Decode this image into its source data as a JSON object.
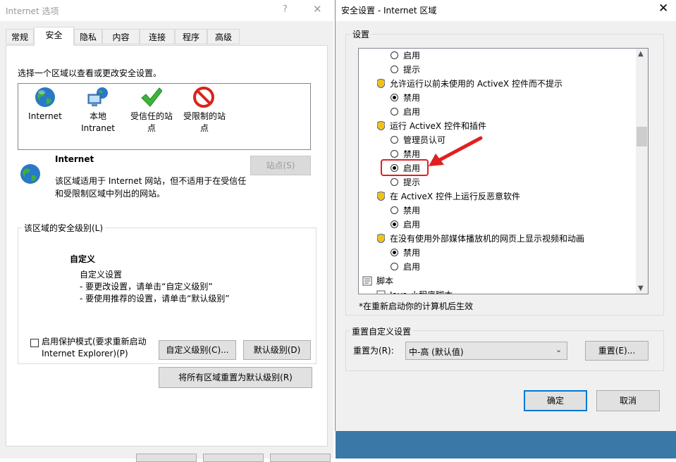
{
  "left": {
    "title": "Internet 选项",
    "help": "?",
    "close": "✕",
    "tabs": [
      "常规",
      "安全",
      "隐私",
      "内容",
      "连接",
      "程序",
      "高级"
    ],
    "active_tab": "安全",
    "zone_prompt": "选择一个区域以查看或更改安全设置。",
    "zones": [
      {
        "label": "Internet",
        "icon": "globe-icon"
      },
      {
        "label": "本地 Intranet",
        "icon": "intranet-icon"
      },
      {
        "label": "受信任的站点",
        "icon": "checkmark-icon"
      },
      {
        "label": "受限制的站点",
        "icon": "restricted-icon"
      }
    ],
    "selected_zone_title": "Internet",
    "selected_zone_desc": "该区域适用于 Internet 网站，但不适用于在受信任和受限制区域中列出的网站。",
    "sites_button": "站点(S)",
    "level_group_label": "该区域的安全级别(L)",
    "level_name": "自定义",
    "level_lines": [
      "自定义设置",
      "- 要更改设置，请单击“自定义级别”",
      "- 要使用推荐的设置，请单击“默认级别”"
    ],
    "protected_mode_label": "启用保护模式(要求重新启动 Internet Explorer)(P)",
    "custom_level_button": "自定义级别(C)...",
    "default_level_button": "默认级别(D)",
    "reset_all_button": "将所有区域重置为默认级别(R)"
  },
  "right": {
    "title": "安全设置 - Internet 区域",
    "close": "✕",
    "settings_label": "设置",
    "rows": [
      {
        "type": "radio",
        "label": "启用",
        "checked": false
      },
      {
        "type": "radio",
        "label": "提示",
        "checked": false
      },
      {
        "type": "heading",
        "label": "允许运行以前未使用的 ActiveX 控件而不提示"
      },
      {
        "type": "radio",
        "label": "禁用",
        "checked": true
      },
      {
        "type": "radio",
        "label": "启用",
        "checked": false
      },
      {
        "type": "heading",
        "label": "运行 ActiveX 控件和插件"
      },
      {
        "type": "radio",
        "label": "管理员认可",
        "checked": false
      },
      {
        "type": "radio",
        "label": "禁用",
        "checked": false
      },
      {
        "type": "radio",
        "label": "启用",
        "checked": true
      },
      {
        "type": "radio",
        "label": "提示",
        "checked": false
      },
      {
        "type": "heading",
        "label": "在 ActiveX 控件上运行反恶意软件"
      },
      {
        "type": "radio",
        "label": "禁用",
        "checked": false
      },
      {
        "type": "radio",
        "label": "启用",
        "checked": true
      },
      {
        "type": "heading",
        "label": "在没有使用外部媒体播放机的网页上显示视频和动画"
      },
      {
        "type": "radio",
        "label": "禁用",
        "checked": true
      },
      {
        "type": "radio",
        "label": "启用",
        "checked": false
      },
      {
        "type": "section",
        "label": "脚本"
      },
      {
        "type": "heading",
        "label": "Java 小程序脚本"
      }
    ],
    "restart_note": "*在重新启动你的计算机后生效",
    "reset_group_label": "重置自定义设置",
    "reset_to_label": "重置为(R):",
    "reset_to_value": "中-高 (默认值)",
    "reset_button": "重置(E)...",
    "ok_button": "确定",
    "cancel_button": "取消"
  },
  "colors": {
    "highlight": "#e02020",
    "selected_border": "#0078d7"
  }
}
